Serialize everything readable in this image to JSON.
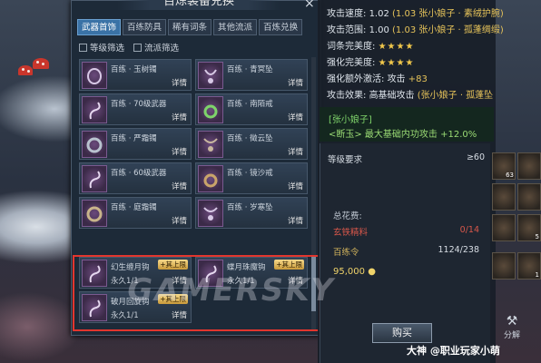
{
  "window": {
    "title": "百炼装备兑换",
    "close": "×"
  },
  "tabs": [
    "武器首饰",
    "百练防具",
    "稀有词条",
    "其他流派",
    "百炼兑换"
  ],
  "filters": [
    "等级筛选",
    "流派筛选"
  ],
  "items": [
    {
      "name": "百练 · 玉树镯",
      "detail": "详情"
    },
    {
      "name": "百练 · 青冥坠",
      "detail": "详情"
    },
    {
      "name": "百练 · 70级武器",
      "detail": "详情"
    },
    {
      "name": "百练 · 南陌戒",
      "detail": "详情"
    },
    {
      "name": "百练 · 严霜镯",
      "detail": "详情"
    },
    {
      "name": "百练 · 徵云坠",
      "detail": "详情"
    },
    {
      "name": "百练 · 60级武器",
      "detail": "详情"
    },
    {
      "name": "百练 · 镜沙戒",
      "detail": "详情"
    },
    {
      "name": "百练 · 庭霜镯",
      "detail": "详情"
    },
    {
      "name": "百练 · 岁寒坠",
      "detail": "详情"
    },
    {
      "name": "幻生缠月钩",
      "badge": "+其上限",
      "perm": "永久1/1",
      "detail": "详情"
    },
    {
      "name": "蝶月珠魔钩",
      "badge": "+其上限",
      "perm": "永久1/1",
      "detail": "详情"
    },
    {
      "name": "破月回旋钩",
      "badge": "+其上限",
      "perm": "永久1/1",
      "detail": "详情"
    }
  ],
  "detail": {
    "stats": [
      {
        "label": "攻击速度:",
        "value": "1.02",
        "extra": "(1.03  张小娘子 · 素绒护腕)"
      },
      {
        "label": "攻击范围:",
        "value": "1.00",
        "extra": "(1.03  张小娘子 · 孤蓬绸缎)"
      }
    ],
    "perfect": {
      "label": "词条完美度:",
      "stars": "★★★★"
    },
    "enhance": {
      "label": "强化完美度:",
      "stars": "★★★★"
    },
    "extra_act": {
      "label": "强化额外激活:",
      "value": "攻击",
      "bonus": "+83"
    },
    "atk_effect": {
      "label": "攻击效果:",
      "value": "高基础攻击",
      "extra": "(张小娘子 · 孤蓬坠"
    },
    "set_name": "[张小娘子]",
    "set_effect": "<断玉> 最大基础内功攻击 +12.0%",
    "level_req_label": "等级要求",
    "level_req_value": "≥60",
    "cost_header": "总花费:",
    "cost1_name": "玄铁精料",
    "cost1_value": "0/14",
    "cost2_name": "百练令",
    "cost2_value": "1124/238",
    "money": "95,000",
    "buy": "购买"
  },
  "inventory": [
    "63",
    "",
    "",
    "",
    "",
    "5",
    "",
    "",
    "1"
  ],
  "decompose": "分解",
  "watermark": "GAMERSKY",
  "footer": "大神 @职业玩家小萌"
}
